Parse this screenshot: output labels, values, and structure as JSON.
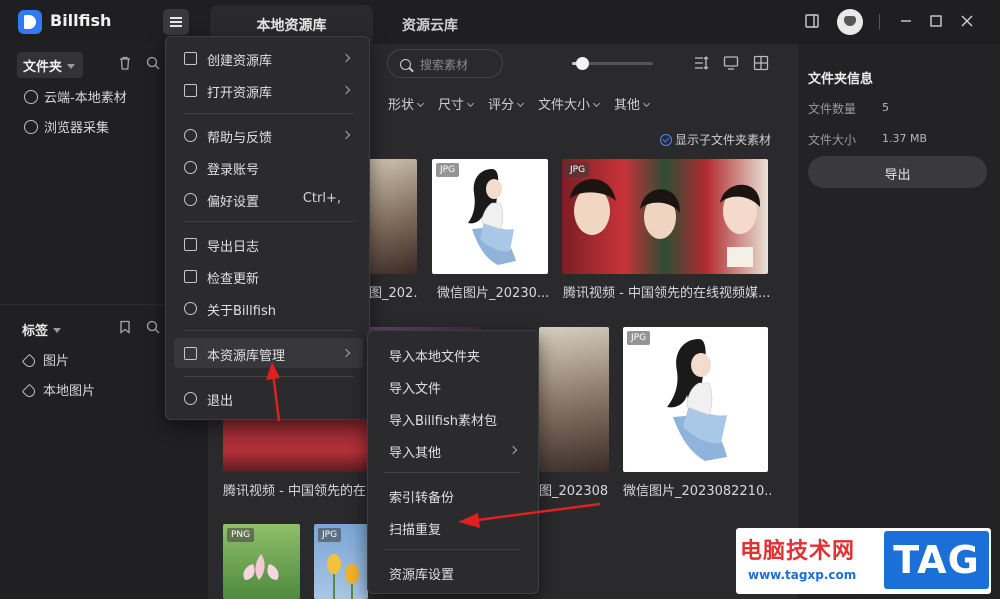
{
  "app": {
    "name": "Billfish"
  },
  "tabs": [
    {
      "label": "本地资源库"
    },
    {
      "label": "资源云库"
    }
  ],
  "sidebar": {
    "folder_header": "文件夹",
    "folders": [
      {
        "label": "云端-本地素材"
      },
      {
        "label": "浏览器采集"
      }
    ],
    "tags_header": "标签",
    "tags": [
      {
        "label": "图片"
      },
      {
        "label": "本地图片"
      }
    ]
  },
  "toolbar": {
    "search_placeholder": "搜索素材",
    "zoom_level": 0.12
  },
  "filters": [
    "形状",
    "尺寸",
    "评分",
    "文件大小",
    "其他"
  ],
  "show_subfolder_label": "显示子文件夹素材",
  "grid": {
    "items": [
      {
        "badge": "",
        "caption": "图_202..."
      },
      {
        "badge": "JPG",
        "caption": "微信图片_20230..."
      },
      {
        "badge": "JPG",
        "caption": "腾讯视频 - 中国领先的在线视频媒..."
      },
      {
        "badge": "",
        "caption": "腾讯视频 - 中国领先的在"
      },
      {
        "badge": "",
        "caption": "图_202308..."
      },
      {
        "badge": "JPG",
        "caption": "微信图片_2023082210..."
      },
      {
        "badge": "PNG",
        "caption": ""
      },
      {
        "badge": "JPG",
        "caption": ""
      }
    ]
  },
  "info_panel": {
    "title": "文件夹信息",
    "count_label": "文件数量",
    "count_value": "5",
    "size_label": "文件大小",
    "size_value": "1.37 MB",
    "export_label": "导出"
  },
  "menu": {
    "items": [
      {
        "label": "创建资源库",
        "submenu": true
      },
      {
        "label": "打开资源库",
        "submenu": true
      },
      {
        "label": "帮助与反馈",
        "submenu": true
      },
      {
        "label": "登录账号"
      },
      {
        "label": "偏好设置",
        "shortcut": "Ctrl+,"
      },
      {
        "label": "导出日志"
      },
      {
        "label": "检查更新"
      },
      {
        "label": "关于Billfish"
      },
      {
        "label": "本资源库管理",
        "submenu": true
      },
      {
        "label": "退出"
      }
    ]
  },
  "submenu": {
    "items": [
      {
        "label": "导入本地文件夹"
      },
      {
        "label": "导入文件"
      },
      {
        "label": "导入Billfish素材包"
      },
      {
        "label": "导入其他",
        "submenu": true
      },
      {
        "label": "索引转备份"
      },
      {
        "label": "扫描重复"
      },
      {
        "label": "资源库设置"
      }
    ]
  },
  "watermark": {
    "text": "电脑技术网",
    "url": "www.tagxp.com",
    "logo": "TAG"
  },
  "colors": {
    "accent": "#2f7bf5",
    "annotation_arrow": "#e02020",
    "check": "#3d8bff"
  }
}
